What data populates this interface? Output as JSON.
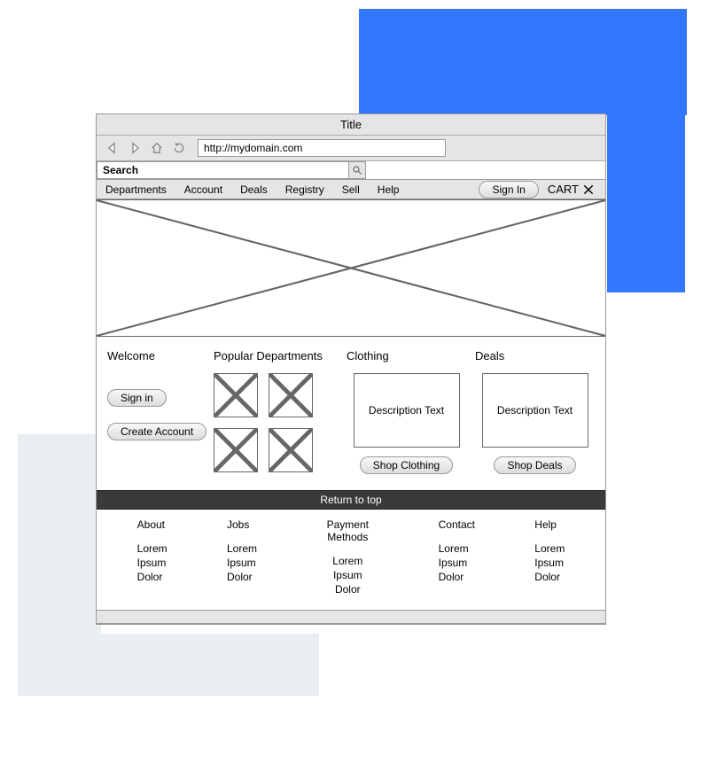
{
  "window": {
    "title": "Title",
    "url": "http://mydomain.com"
  },
  "search": {
    "placeholder": "Search"
  },
  "menu": {
    "items": [
      "Departments",
      "Account",
      "Deals",
      "Registry",
      "Sell",
      "Help"
    ],
    "sign_in": "Sign In",
    "cart": "CART"
  },
  "sections": {
    "welcome": {
      "heading": "Welcome",
      "sign_in": "Sign in",
      "create_account": "Create Account"
    },
    "popular": {
      "heading": "Popular Departments"
    },
    "clothing": {
      "heading": "Clothing",
      "desc": "Description Text",
      "button": "Shop Clothing"
    },
    "deals": {
      "heading": "Deals",
      "desc": "Description Text",
      "button": "Shop Deals"
    }
  },
  "footer": {
    "return": "Return to top",
    "cols": [
      {
        "head": "About",
        "lines": [
          "Lorem",
          "Ipsum",
          "Dolor"
        ]
      },
      {
        "head": "Jobs",
        "lines": [
          "Lorem",
          "Ipsum",
          "Dolor"
        ]
      },
      {
        "head": "Payment Methods",
        "lines": [
          "Lorem",
          "Ipsum",
          "Dolor"
        ]
      },
      {
        "head": "Contact",
        "lines": [
          "Lorem",
          "Ipsum",
          "Dolor"
        ]
      },
      {
        "head": "Help",
        "lines": [
          "Lorem",
          "Ipsum",
          "Dolor"
        ]
      }
    ]
  }
}
